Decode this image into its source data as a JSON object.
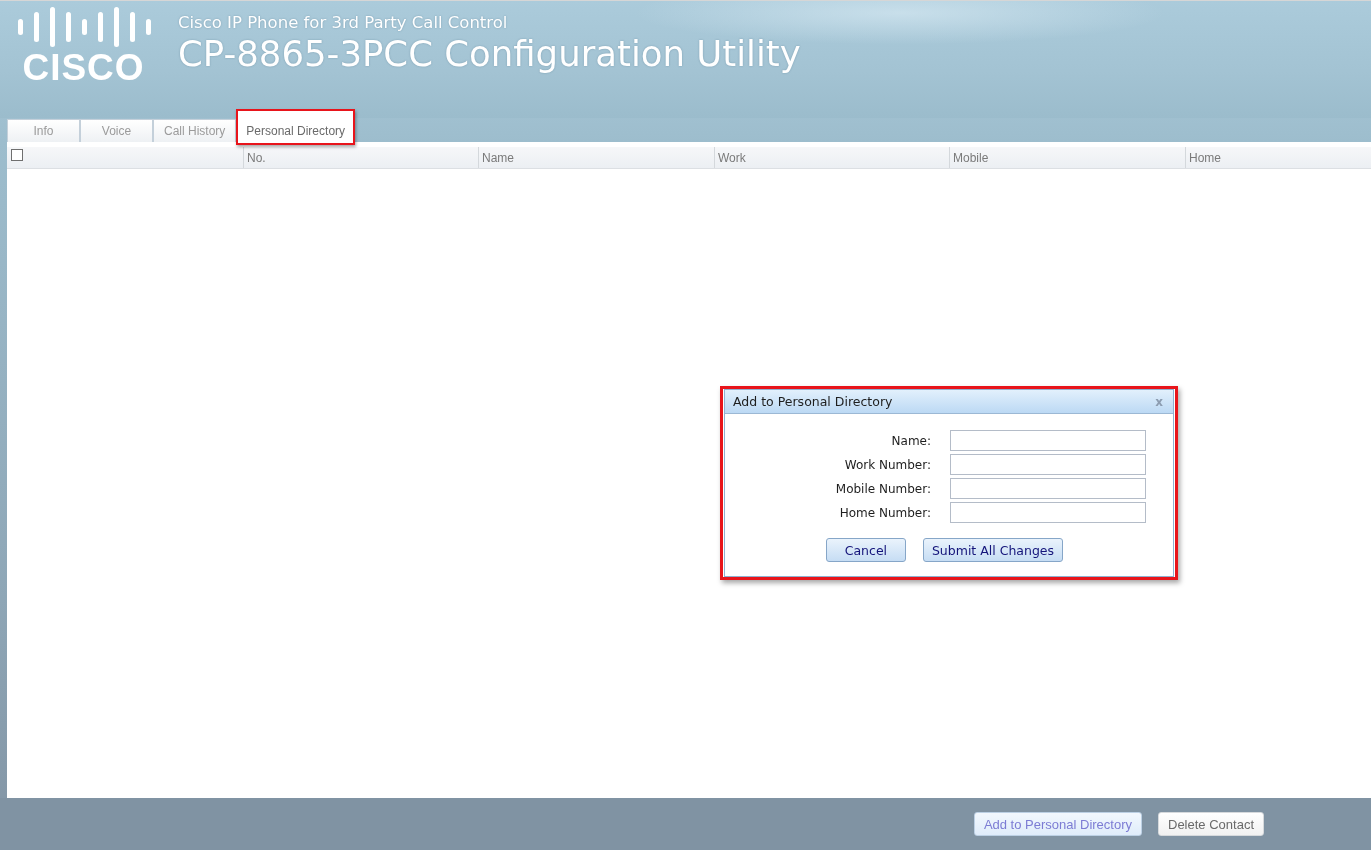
{
  "header": {
    "logo_text": "CISCO",
    "subtitle": "Cisco IP Phone for 3rd Party Call Control",
    "title": "CP-8865-3PCC Configuration Utility"
  },
  "tabs": [
    {
      "label": "Info",
      "selected": false,
      "highlighted": false
    },
    {
      "label": "Voice",
      "selected": false,
      "highlighted": false
    },
    {
      "label": "Call History",
      "selected": false,
      "highlighted": false
    },
    {
      "label": "Personal Directory",
      "selected": true,
      "highlighted": true
    }
  ],
  "table": {
    "columns": [
      {
        "kind": "checkbox",
        "checked": false
      },
      {
        "kind": "text",
        "label": "No."
      },
      {
        "kind": "text",
        "label": "Name"
      },
      {
        "kind": "text",
        "label": "Work"
      },
      {
        "kind": "text",
        "label": "Mobile"
      },
      {
        "kind": "text",
        "label": "Home"
      }
    ]
  },
  "dialog": {
    "title": "Add to Personal Directory",
    "close_label": "x",
    "highlighted": true,
    "fields": [
      {
        "label": "Name:"
      },
      {
        "label": "Work Number:"
      },
      {
        "label": "Mobile Number:"
      },
      {
        "label": "Home Number:"
      }
    ],
    "buttons": [
      {
        "label": "Cancel"
      },
      {
        "label": "Submit All Changes"
      }
    ]
  },
  "footer_buttons": [
    {
      "label": "Add to Personal Directory",
      "active": true
    },
    {
      "label": "Delete Contact",
      "active": false
    }
  ]
}
